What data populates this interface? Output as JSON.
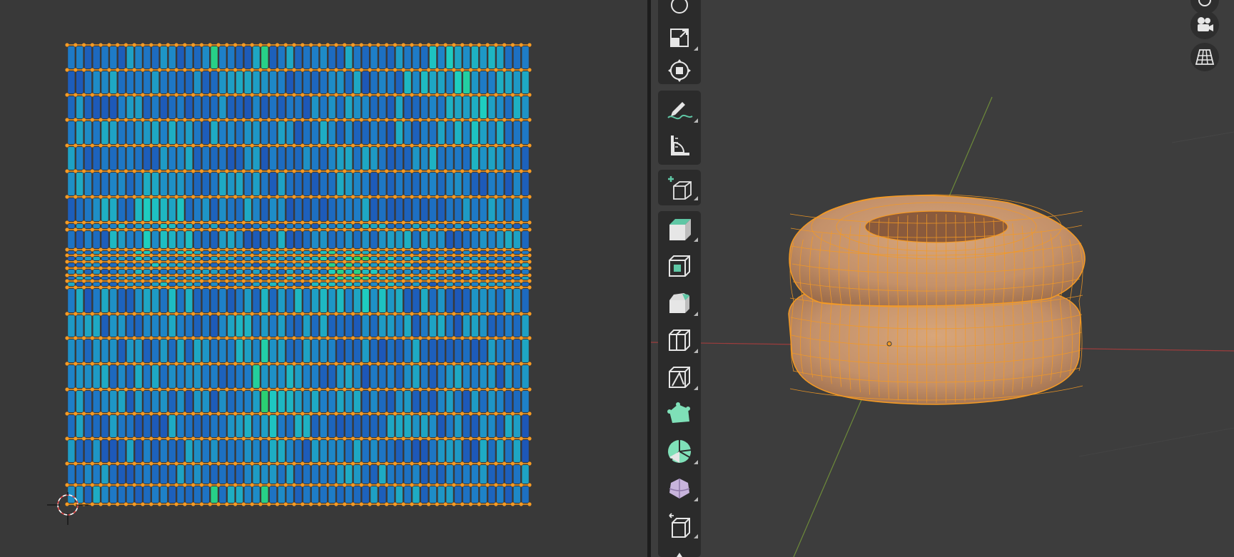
{
  "ui": {
    "accent_selection": "#f59a23",
    "uv_fill_low": "#1b2fa8",
    "uv_fill_mid": "#1e7fc8",
    "uv_fill_high": "#1ecfc0",
    "uv_fill_peak": "#2bd06a",
    "mesh_color": "#d9a46a",
    "axis_x_color": "#9c3d3d",
    "axis_y_color": "#6d8a3a"
  },
  "uv_editor": {
    "cursor_icon": "2d-cursor-icon",
    "grid": {
      "columns": 55,
      "rows": 20,
      "dense_band_rows": [
        9,
        10
      ]
    },
    "stretch_display": "area-stretch-heatmap"
  },
  "toolbar": {
    "tools": [
      {
        "name": "rotate-tool",
        "icon": "rotate-icon"
      },
      {
        "name": "scale-tool",
        "icon": "scale-icon"
      },
      {
        "name": "transform-tool",
        "icon": "transform-icon"
      },
      {
        "name": "annotate-tool",
        "icon": "annotate-pencil-icon"
      },
      {
        "name": "measure-tool",
        "icon": "measure-ruler-icon"
      },
      {
        "name": "add-cube-tool",
        "icon": "add-cube-icon"
      },
      {
        "name": "extrude-region-tool",
        "icon": "extrude-icon"
      },
      {
        "name": "inset-faces-tool",
        "icon": "inset-icon"
      },
      {
        "name": "bevel-tool",
        "icon": "bevel-icon"
      },
      {
        "name": "loop-cut-tool",
        "icon": "loop-cut-icon"
      },
      {
        "name": "knife-tool",
        "icon": "knife-icon"
      },
      {
        "name": "poly-build-tool",
        "icon": "poly-build-icon"
      },
      {
        "name": "spin-tool",
        "icon": "spin-icon"
      },
      {
        "name": "smooth-tool",
        "icon": "smooth-sphere-icon"
      },
      {
        "name": "edge-slide-tool",
        "icon": "edge-slide-icon"
      },
      {
        "name": "shrink-fatten-tool",
        "icon": "shrink-icon"
      }
    ]
  },
  "viewport_nav": {
    "buttons": [
      {
        "name": "nav-top-button",
        "icon": "zoom-icon"
      },
      {
        "name": "toggle-camera-view-button",
        "icon": "camera-icon"
      },
      {
        "name": "toggle-perspective-button",
        "icon": "ortho-grid-icon"
      }
    ]
  },
  "scene": {
    "object": "torus-mesh",
    "mode": "edit-mode-selected"
  }
}
